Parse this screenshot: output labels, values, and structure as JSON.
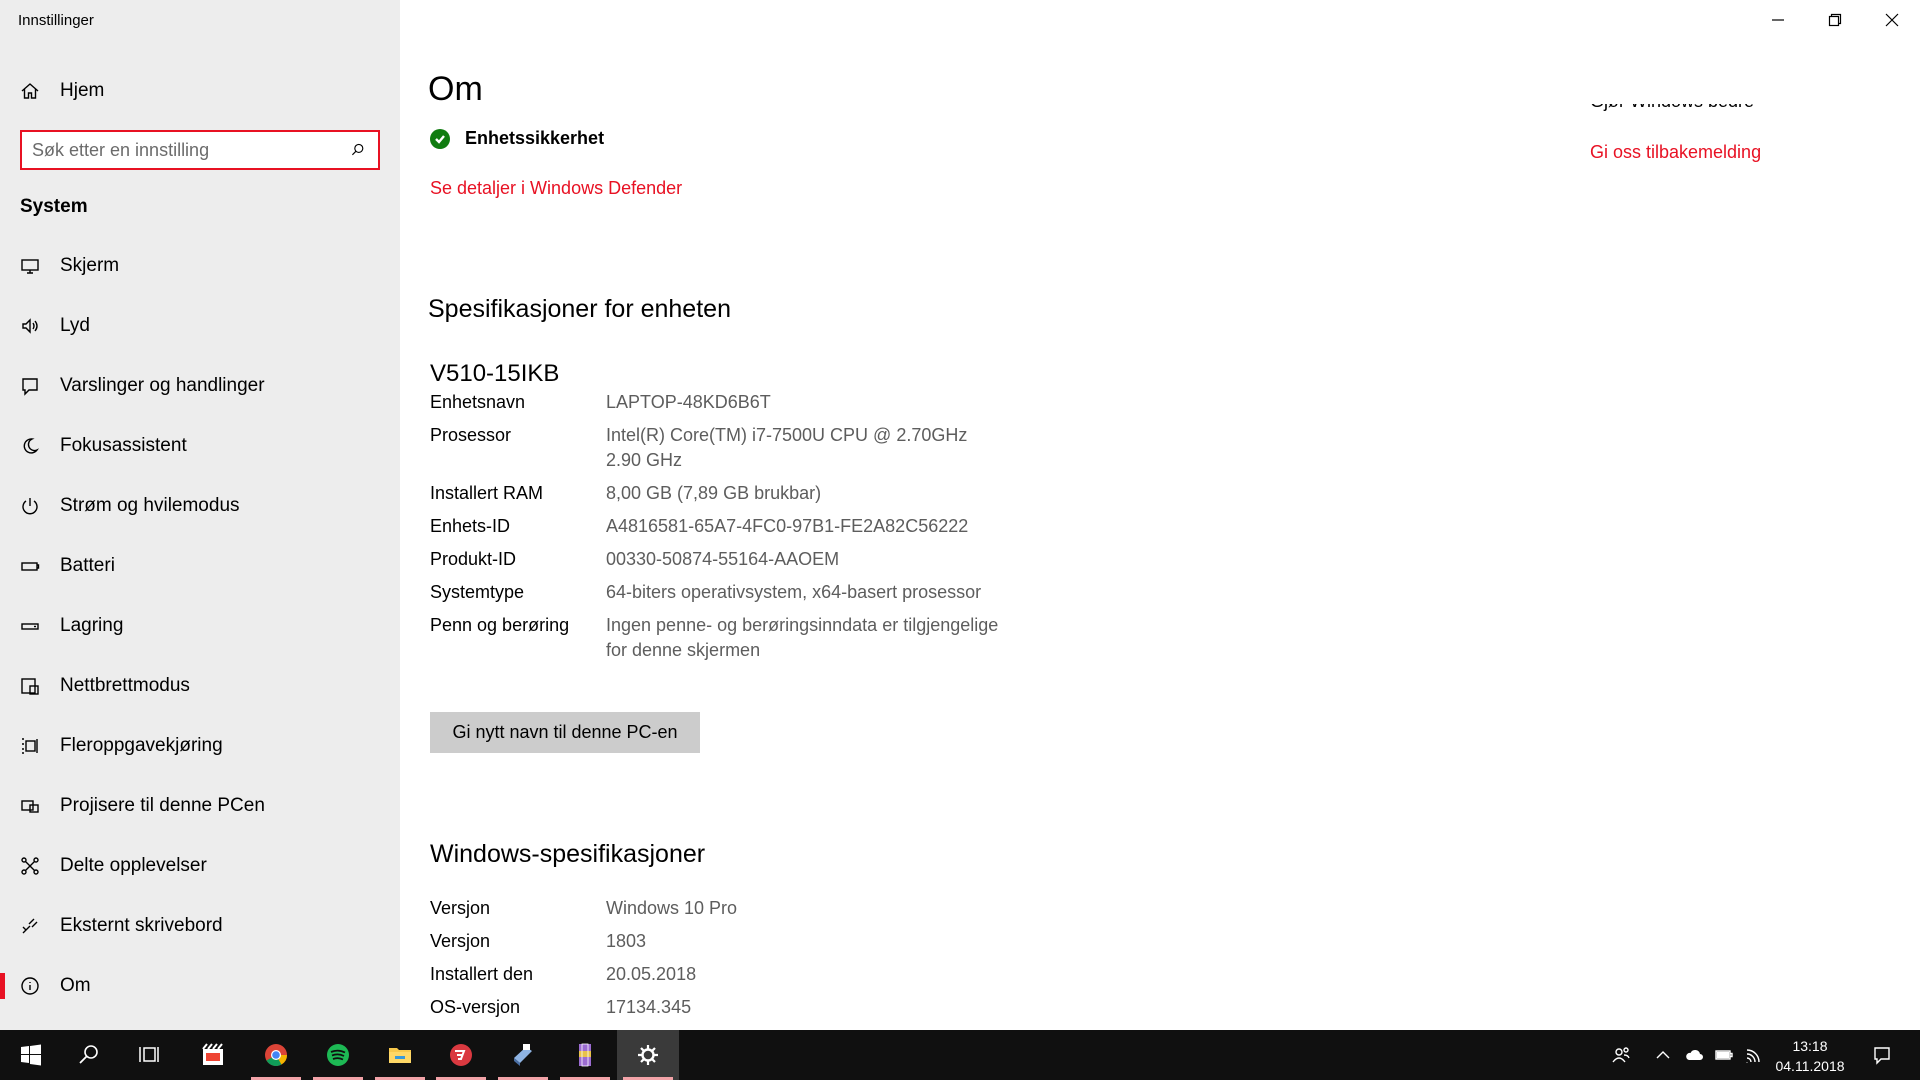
{
  "window": {
    "title": "Innstillinger"
  },
  "sidebar": {
    "home_label": "Hjem",
    "search_placeholder": "Søk etter en innstilling",
    "section_label": "System",
    "items": [
      {
        "label": "Skjerm",
        "icon": "monitor-icon"
      },
      {
        "label": "Lyd",
        "icon": "speaker-icon"
      },
      {
        "label": "Varslinger og handlinger",
        "icon": "notification-icon"
      },
      {
        "label": "Fokusassistent",
        "icon": "moon-icon"
      },
      {
        "label": "Strøm og hvilemodus",
        "icon": "power-icon"
      },
      {
        "label": "Batteri",
        "icon": "battery-icon"
      },
      {
        "label": "Lagring",
        "icon": "storage-icon"
      },
      {
        "label": "Nettbrettmodus",
        "icon": "tablet-icon"
      },
      {
        "label": "Fleroppgavekjøring",
        "icon": "multitask-icon"
      },
      {
        "label": "Projisere til denne PCen",
        "icon": "project-icon"
      },
      {
        "label": "Delte opplevelser",
        "icon": "share-icon"
      },
      {
        "label": "Eksternt skrivebord",
        "icon": "remote-icon"
      },
      {
        "label": "Om",
        "icon": "info-icon",
        "active": true
      }
    ]
  },
  "main": {
    "title": "Om",
    "security": {
      "label": "Enhetssikkerhet",
      "link": "Se detaljer i Windows Defender"
    },
    "side": {
      "partial_heading": "Gjør Windows bedre",
      "feedback_link": "Gi oss tilbakemelding"
    },
    "device_specs": {
      "heading": "Spesifikasjoner for enheten",
      "device_name": "V510-15IKB",
      "rows": [
        {
          "key": "Enhetsnavn",
          "value": "LAPTOP-48KD6B6T"
        },
        {
          "key": "Prosessor",
          "value": "Intel(R) Core(TM) i7-7500U CPU @ 2.70GHz 2.90 GHz"
        },
        {
          "key": "Installert RAM",
          "value": "8,00 GB (7,89 GB brukbar)"
        },
        {
          "key": "Enhets-ID",
          "value": "A4816581-65A7-4FC0-97B1-FE2A82C56222"
        },
        {
          "key": "Produkt-ID",
          "value": "00330-50874-55164-AAOEM"
        },
        {
          "key": "Systemtype",
          "value": "64-biters operativsystem, x64-basert prosessor"
        },
        {
          "key": "Penn og berøring",
          "value": "Ingen penne- og berøringsinndata er tilgjengelige for denne skjermen"
        }
      ],
      "rename_button": "Gi nytt navn til denne PC-en"
    },
    "windows_specs": {
      "heading": "Windows-spesifikasjoner",
      "rows": [
        {
          "key": "Versjon",
          "value": "Windows 10 Pro"
        },
        {
          "key": "Versjon",
          "value": "1803"
        },
        {
          "key": "Installert den",
          "value": "20.05.2018"
        },
        {
          "key": "OS-versjon",
          "value": "17134.345"
        }
      ]
    }
  },
  "taskbar": {
    "apps": [
      "windows-start-icon",
      "search-icon",
      "task-view-icon",
      "movie-maker-icon",
      "chrome-icon",
      "spotify-icon",
      "file-explorer-icon",
      "expressvpn-icon",
      "scanner-icon",
      "winrar-icon",
      "settings-gear-icon"
    ],
    "time": "13:18",
    "date": "04.11.2018"
  },
  "colors": {
    "accent": "#e81123",
    "sidebar_bg": "#ededed",
    "taskbar_bg": "#101010",
    "check_green": "#107c10"
  }
}
